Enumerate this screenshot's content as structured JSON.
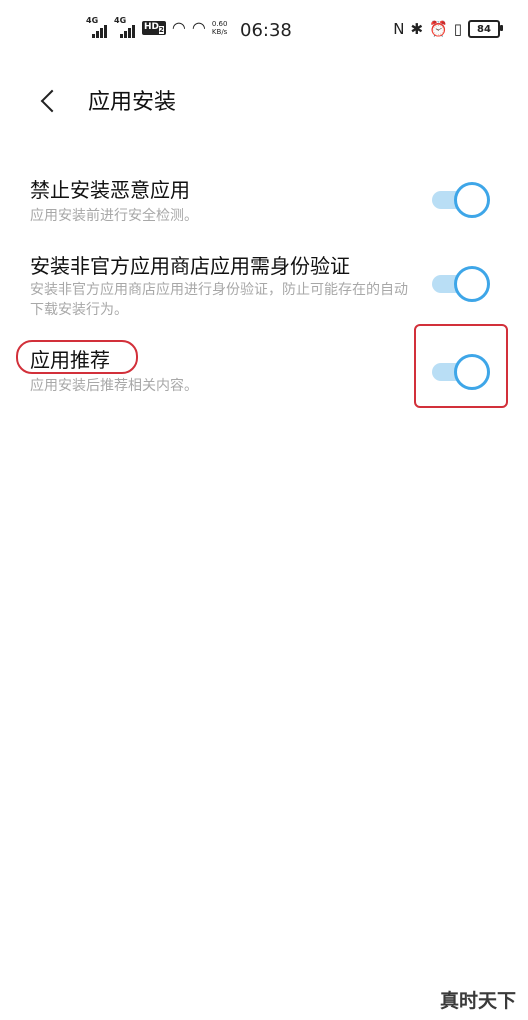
{
  "status_bar": {
    "signal1_tag": "4G",
    "signal2_tag": "4G",
    "hd_label": "HD",
    "hd_sub": "2",
    "speed_value": "0.60",
    "speed_unit": "KB/s",
    "time": "06:38",
    "nfc_icon": "N",
    "battery": "84"
  },
  "header": {
    "title": "应用安装"
  },
  "settings": [
    {
      "title": "禁止安装恶意应用",
      "desc": "应用安装前进行安全检测。",
      "enabled": true
    },
    {
      "title": "安装非官方应用商店应用需身份验证",
      "desc": "安装非官方应用商店应用进行身份验证，防止可能存在的自动下载安装行为。",
      "enabled": true
    },
    {
      "title": "应用推荐",
      "desc": "应用安装后推荐相关内容。",
      "enabled": true
    }
  ],
  "colors": {
    "toggle_track": "#b9def5",
    "toggle_knob_border": "#3ea6e8",
    "annotation_red": "#d2303a"
  },
  "watermark": "真时天下"
}
